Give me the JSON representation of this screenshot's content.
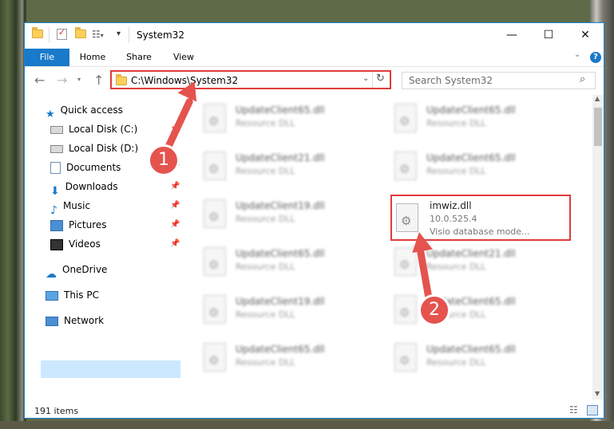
{
  "window": {
    "title": "System32",
    "minimize": "—",
    "maximize": "☐",
    "close": "✕"
  },
  "ribbon": {
    "tabs": [
      "File",
      "Home",
      "Share",
      "View"
    ],
    "help": "?"
  },
  "address": {
    "path": "C:\\Windows\\System32",
    "search_placeholder": "Search System32"
  },
  "sidebar": {
    "items": [
      {
        "label": "Quick access",
        "icon": "star-icon",
        "pinned": false
      },
      {
        "label": "Local Disk (C:)",
        "icon": "drive-icon",
        "pinned": true
      },
      {
        "label": "Local Disk (D:)",
        "icon": "drive-icon",
        "pinned": false
      },
      {
        "label": "Documents",
        "icon": "documents-icon",
        "pinned": true
      },
      {
        "label": "Downloads",
        "icon": "downloads-icon",
        "pinned": true
      },
      {
        "label": "Music",
        "icon": "music-icon",
        "pinned": true
      },
      {
        "label": "Pictures",
        "icon": "pictures-icon",
        "pinned": true
      },
      {
        "label": "Videos",
        "icon": "videos-icon",
        "pinned": true
      },
      {
        "label": "OneDrive",
        "icon": "onedrive-icon",
        "pinned": false
      },
      {
        "label": "This PC",
        "icon": "pc-icon",
        "pinned": false,
        "selected": true
      },
      {
        "label": "Network",
        "icon": "network-icon",
        "pinned": false
      }
    ]
  },
  "files": {
    "left": [
      {
        "name": "UpdateClient65.dll",
        "desc": "Resource DLL"
      },
      {
        "name": "UpdateClient21.dll",
        "desc": "Resource DLL"
      },
      {
        "name": "UpdateClient19.dll",
        "desc": "Resource DLL"
      },
      {
        "name": "UpdateClient65.dll",
        "desc": "Resource DLL"
      },
      {
        "name": "UpdateClient19.dll",
        "desc": "Resource DLL"
      },
      {
        "name": "UpdateClient65.dll",
        "desc": "Resource DLL"
      }
    ],
    "right": [
      {
        "name": "UpdateClient65.dll",
        "desc": "Resource DLL"
      },
      {
        "name": "UpdateClient65.dll",
        "desc": "Resource DLL"
      },
      {
        "name": "UpdateClient21.dll",
        "desc": "Resource DLL"
      },
      {
        "name": "UpdateClient65.dll",
        "desc": "Resource DLL"
      },
      {
        "name": "UpdateClient65.dll",
        "desc": "Resource DLL"
      }
    ],
    "highlighted": {
      "name": "imwiz.dll",
      "version": "10.0.525.4",
      "desc": "Visio database mode..."
    }
  },
  "status": {
    "count": "191 items"
  },
  "callouts": {
    "one": "1",
    "two": "2"
  },
  "colors": {
    "accent": "#1979ca",
    "highlight_red": "#e03c3c",
    "selected_bg": "#cce8ff"
  }
}
